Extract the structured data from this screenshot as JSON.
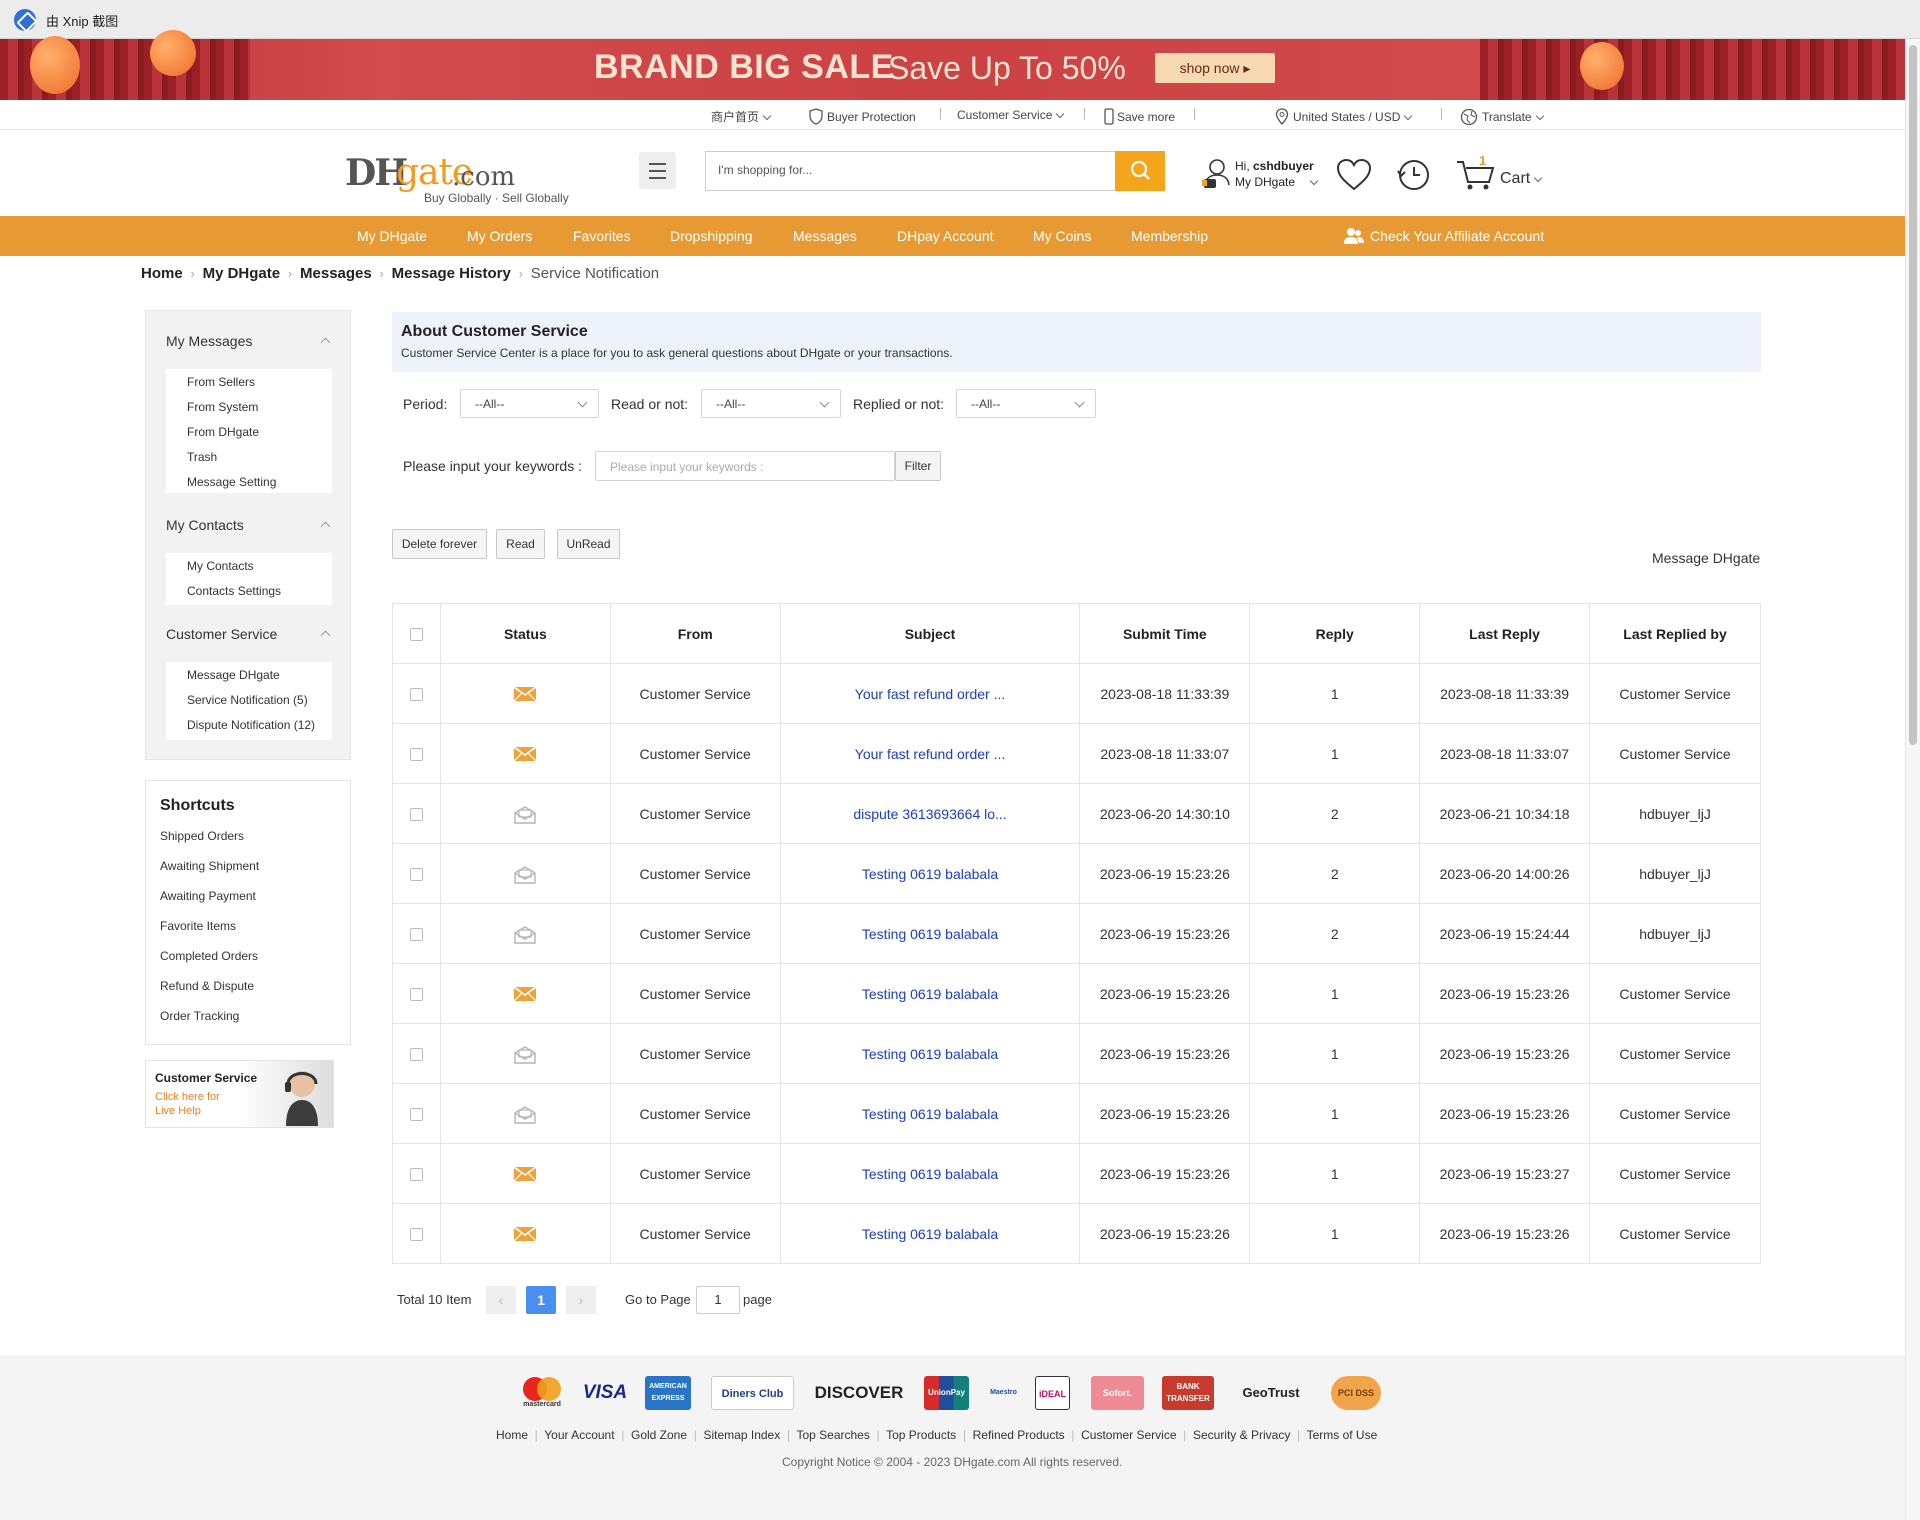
{
  "window": {
    "title": "由 Xnip 截图"
  },
  "banner": {
    "title": "BRAND BIG SALE",
    "subtitle": "Save Up To 50%",
    "cta": "shop now ▸"
  },
  "top_links": {
    "merchant": "商户首页",
    "buyer_protection": "Buyer Protection",
    "customer_service": "Customer Service",
    "save_more": "Save more",
    "region": "United States / USD",
    "translate": "Translate"
  },
  "header": {
    "logo_dh": "DH",
    "logo_gate": "gate",
    "logo_com": ".com",
    "tagline": "Buy Globally · Sell Globally",
    "search_placeholder": "I'm shopping for...",
    "greeting": "Hi, ",
    "username": "cshdbuyer",
    "my_dhgate": "My DHgate",
    "cart_label": "Cart",
    "cart_count": "1"
  },
  "nav": {
    "items": [
      "My DHgate",
      "My Orders",
      "Favorites",
      "Dropshipping",
      "Messages",
      "DHpay Account",
      "My Coins",
      "Membership"
    ],
    "affiliate": "Check Your Affiliate Account"
  },
  "breadcrumb": [
    "Home",
    "My DHgate",
    "Messages",
    "Message History",
    "Service Notification"
  ],
  "sidebar": {
    "my_messages": {
      "title": "My Messages",
      "items": [
        "From Sellers",
        "From System",
        "From DHgate",
        "Trash",
        "Message Setting"
      ]
    },
    "my_contacts": {
      "title": "My Contacts",
      "items": [
        "My Contacts",
        "Contacts Settings"
      ]
    },
    "customer_service": {
      "title": "Customer Service",
      "items": [
        "Message DHgate",
        "Service Notification (5)",
        "Dispute Notification (12)"
      ]
    }
  },
  "shortcuts": {
    "title": "Shortcuts",
    "items": [
      "Shipped Orders",
      "Awaiting Shipment",
      "Awaiting Payment",
      "Favorite Items",
      "Completed Orders",
      "Refund & Dispute",
      "Order Tracking"
    ]
  },
  "cs_banner": {
    "title": "Customer Service",
    "line1": "Click here for",
    "line2": "Live Help"
  },
  "about": {
    "title": "About Customer Service",
    "desc": "Customer Service Center is a place for you to ask general questions about DHgate or your transactions."
  },
  "filters": {
    "period_label": "Period:",
    "period_value": "--All--",
    "read_label": "Read or not:",
    "read_value": "--All--",
    "replied_label": "Replied or not:",
    "replied_value": "--All--",
    "keyword_label": "Please input your keywords :",
    "keyword_placeholder": "Please input your keywords :",
    "filter_button": "Filter"
  },
  "actions": {
    "delete": "Delete forever",
    "read": "Read",
    "unread": "UnRead",
    "message_dhgate": "Message DHgate"
  },
  "table": {
    "headers": [
      "Status",
      "From",
      "Subject",
      "Submit Time",
      "Reply",
      "Last Reply",
      "Last Replied by"
    ],
    "rows": [
      {
        "status": "unread",
        "from": "Customer Service",
        "subject": "Your fast refund order ...",
        "submit": "2023-08-18 11:33:39",
        "reply": "1",
        "last_reply": "2023-08-18 11:33:39",
        "last_by": "Customer Service"
      },
      {
        "status": "unread",
        "from": "Customer Service",
        "subject": "Your fast refund order ...",
        "submit": "2023-08-18 11:33:07",
        "reply": "1",
        "last_reply": "2023-08-18 11:33:07",
        "last_by": "Customer Service"
      },
      {
        "status": "read",
        "from": "Customer Service",
        "subject": "dispute 3613693664 lo...",
        "submit": "2023-06-20 14:30:10",
        "reply": "2",
        "last_reply": "2023-06-21 10:34:18",
        "last_by": "hdbuyer_ljJ"
      },
      {
        "status": "read",
        "from": "Customer Service",
        "subject": "Testing 0619 balabala",
        "submit": "2023-06-19 15:23:26",
        "reply": "2",
        "last_reply": "2023-06-20 14:00:26",
        "last_by": "hdbuyer_ljJ"
      },
      {
        "status": "read",
        "from": "Customer Service",
        "subject": "Testing 0619 balabala",
        "submit": "2023-06-19 15:23:26",
        "reply": "2",
        "last_reply": "2023-06-19 15:24:44",
        "last_by": "hdbuyer_ljJ"
      },
      {
        "status": "unread",
        "from": "Customer Service",
        "subject": "Testing 0619 balabala",
        "submit": "2023-06-19 15:23:26",
        "reply": "1",
        "last_reply": "2023-06-19 15:23:26",
        "last_by": "Customer Service"
      },
      {
        "status": "read",
        "from": "Customer Service",
        "subject": "Testing 0619 balabala",
        "submit": "2023-06-19 15:23:26",
        "reply": "1",
        "last_reply": "2023-06-19 15:23:26",
        "last_by": "Customer Service"
      },
      {
        "status": "read",
        "from": "Customer Service",
        "subject": "Testing 0619 balabala",
        "submit": "2023-06-19 15:23:26",
        "reply": "1",
        "last_reply": "2023-06-19 15:23:26",
        "last_by": "Customer Service"
      },
      {
        "status": "unread",
        "from": "Customer Service",
        "subject": "Testing 0619 balabala",
        "submit": "2023-06-19 15:23:26",
        "reply": "1",
        "last_reply": "2023-06-19 15:23:27",
        "last_by": "Customer Service"
      },
      {
        "status": "unread",
        "from": "Customer Service",
        "subject": "Testing 0619 balabala",
        "submit": "2023-06-19 15:23:26",
        "reply": "1",
        "last_reply": "2023-06-19 15:23:26",
        "last_by": "Customer Service"
      }
    ]
  },
  "pagination": {
    "total": "Total 10 Item",
    "current": "1",
    "goto_label": "Go to Page",
    "goto_value": "1",
    "page_word": "page"
  },
  "footer": {
    "payments": [
      "mastercard",
      "VISA",
      "AMERICAN EXPRESS",
      "Diners Club",
      "DISCOVER",
      "UnionPay",
      "Maestro",
      "iDEAL",
      "Sofort.",
      "BANK TRANSFER",
      "GeoTrust",
      "PCI DSS"
    ],
    "links": [
      "Home",
      "Your Account",
      "Gold Zone",
      "Sitemap Index",
      "Top Searches",
      "Top Products",
      "Refined Products",
      "Customer Service",
      "Security & Privacy",
      "Terms of Use"
    ],
    "copyright": "Copyright Notice © 2004 - 2023 DHgate.com All rights reserved."
  },
  "colors": {
    "nav": "#e79a33",
    "search_button": "#f4a51c",
    "link": "#1c3dbf",
    "page_active": "#4a8ef0",
    "about_bg": "#eef3fb"
  }
}
